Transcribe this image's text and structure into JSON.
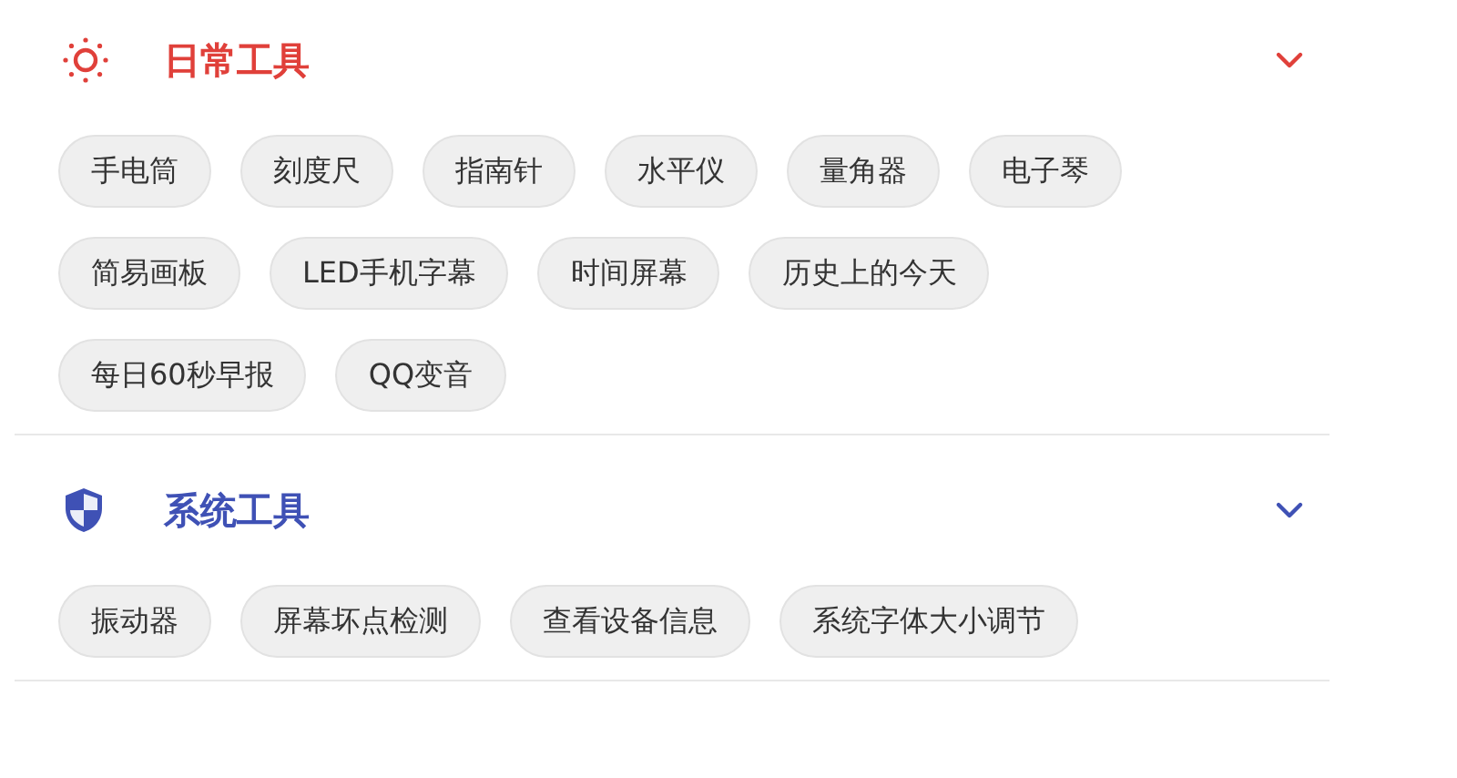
{
  "sections": [
    {
      "kind": "sun",
      "title": "日常工具",
      "color": "#e0403a",
      "tools": [
        "手电筒",
        "刻度尺",
        "指南针",
        "水平仪",
        "量角器",
        "电子琴",
        "简易画板",
        "LED手机字幕",
        "时间屏幕",
        "历史上的今天",
        "每日60秒早报",
        "QQ变音"
      ]
    },
    {
      "kind": "shield",
      "title": "系统工具",
      "color": "#3f51b5",
      "tools": [
        "振动器",
        "屏幕坏点检测",
        "查看设备信息",
        "系统字体大小调节"
      ]
    }
  ]
}
